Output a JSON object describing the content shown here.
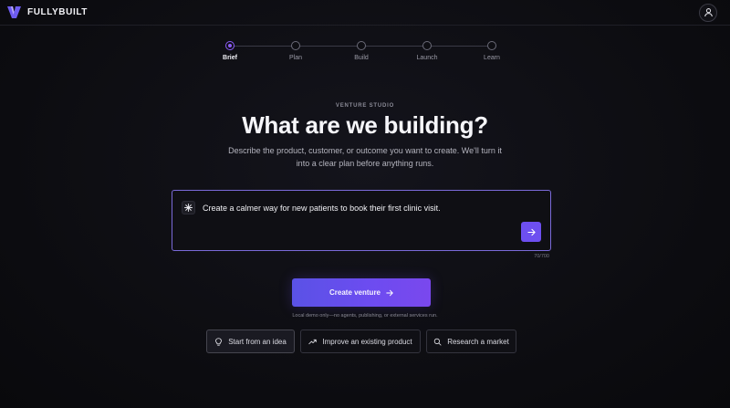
{
  "header": {
    "brand": "FULLYBUILT",
    "logo_icon": "fullybuilt-logo-icon",
    "account_icon": "user-icon"
  },
  "stepper": {
    "steps": [
      {
        "label": "Brief",
        "active": true
      },
      {
        "label": "Plan",
        "active": false
      },
      {
        "label": "Build",
        "active": false
      },
      {
        "label": "Launch",
        "active": false
      },
      {
        "label": "Learn",
        "active": false
      }
    ]
  },
  "hero": {
    "eyebrow": "VENTURE STUDIO",
    "title": "What are we building?",
    "subtitle": "Describe the product, customer, or outcome you want to create. We'll turn it into a clear plan before anything runs."
  },
  "prompt": {
    "value": "Create a calmer way for new patients to book their first clinic visit.",
    "char_count": "70/700",
    "spark_icon": "sparkle-icon",
    "send_icon": "arrow-right-icon"
  },
  "actions": {
    "create_label": "Create venture",
    "create_icon": "arrow-right-icon",
    "note": "Local demo only—no agents, publishing, or external services run."
  },
  "chips": [
    {
      "label": "Start from an idea",
      "icon": "lightbulb-icon",
      "active": true
    },
    {
      "label": "Improve an existing product",
      "icon": "trending-up-icon",
      "active": false
    },
    {
      "label": "Research a market",
      "icon": "search-icon",
      "active": false
    }
  ],
  "colors": {
    "accent": "#6d4ff0",
    "background": "#0c0c10",
    "prompt_border": "#7a6ad8"
  }
}
